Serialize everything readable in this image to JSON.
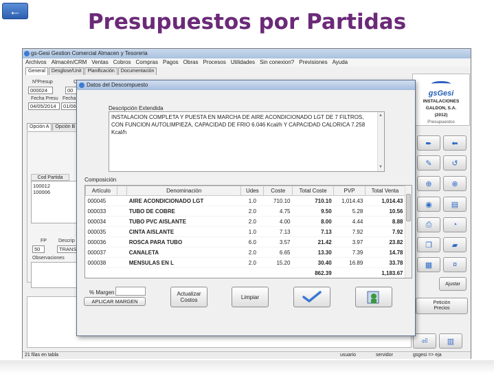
{
  "slide": {
    "title": "Presupuestos por Partidas",
    "back_glyph": "←"
  },
  "app": {
    "title": "gs-Gesi Gestion Comercial Almacen y Tesoreria",
    "menu": [
      "Archivos",
      "Almacén/CRM",
      "Ventas",
      "Cobros",
      "Compras",
      "Pagos",
      "Obras",
      "Procesos",
      "Utilidades",
      "Sin conexion?",
      "Previsiones",
      "Ayuda"
    ],
    "tabs": [
      "General",
      "Desglose/Unit",
      "Planificación",
      "Documentación"
    ],
    "nro_presup_label": "NºPresup",
    "nro_presup_value": "000024",
    "col2_partial_label": "C",
    "col2_partial_value": "00",
    "fecha_presu_label": "Fecha Presu",
    "fecha_presu_value": "04/05/2014",
    "fecha_label": "Fecha",
    "fecha_value": "01/06",
    "opcion_tabs": [
      "Opción A",
      "Opción B"
    ],
    "cod_partida_label": "Cod Partida",
    "partidas": [
      "100012",
      "100006"
    ],
    "fp_label": "FP",
    "fp_value": "50",
    "descrip_label": "Descrip",
    "descrip_value": "TRANS",
    "observaciones_label": "Observaciones",
    "status_left": "21 filas en tabla",
    "status_user": "usuario",
    "status_server": "servidor",
    "status_app": "gsgesi => eja"
  },
  "side": {
    "logo": "gsGesi",
    "company_line1": "INSTALACIONES",
    "company_line2": "GALDON, S.A.",
    "company_line3": "(2012)",
    "section": "Presupuestos",
    "ajustar_label": "Ajustar",
    "peticion_line1": "Petición",
    "peticion_line2": "Precios"
  },
  "dialog": {
    "title": "Datos del Descompuesto",
    "desc_label": "Descripción Extendida",
    "desc_text": "INSTALACION COMPLETA Y PUESTA EN MARCHA DE AIRE ACONDICIONADO LGT DE 7 FILTROS, CON FUNCION AUTOLIMPIEZA, CAPACIDAD DE FRIO 6.046 Kcal/h Y CAPACIDAD CALORICA 7.258 Kcal/h",
    "comp_label": "Composición",
    "columns": [
      "Artículo",
      "",
      "Denominación",
      "Udes",
      "Coste",
      "Total Coste",
      "PVP",
      "Total Venta"
    ],
    "rows": [
      [
        "000045",
        "AIRE ACONDICIONADO LGT",
        "1.0",
        "710.10",
        "710.10",
        "1,014.43",
        "1,014.43"
      ],
      [
        "000033",
        "TUBO DE COBRE",
        "2.0",
        "4.75",
        "9.50",
        "5.28",
        "10.56"
      ],
      [
        "000034",
        "TUBO PVC AISLANTE",
        "2.0",
        "4.00",
        "8.00",
        "4.44",
        "8.88"
      ],
      [
        "000035",
        "CINTA AISLANTE",
        "1.0",
        "7.13",
        "7.13",
        "7.92",
        "7.92"
      ],
      [
        "000036",
        "ROSCA PARA TUBO",
        "6.0",
        "3.57",
        "21.42",
        "3.97",
        "23.82"
      ],
      [
        "000037",
        "CANALETA",
        "2.0",
        "6.65",
        "13.30",
        "7.39",
        "14.78"
      ],
      [
        "000038",
        "MENSULAS EN L",
        "2.0",
        "15.20",
        "30.40",
        "16.89",
        "33.78"
      ]
    ],
    "total_coste": "862.39",
    "total_venta": "1,183.67",
    "margen_label": "% Margen",
    "aplicar_label": "APLICAR MARGEN",
    "actualizar_line1": "Actualizar",
    "actualizar_line2": "Costos",
    "limpiar_label": "Limpiar"
  }
}
